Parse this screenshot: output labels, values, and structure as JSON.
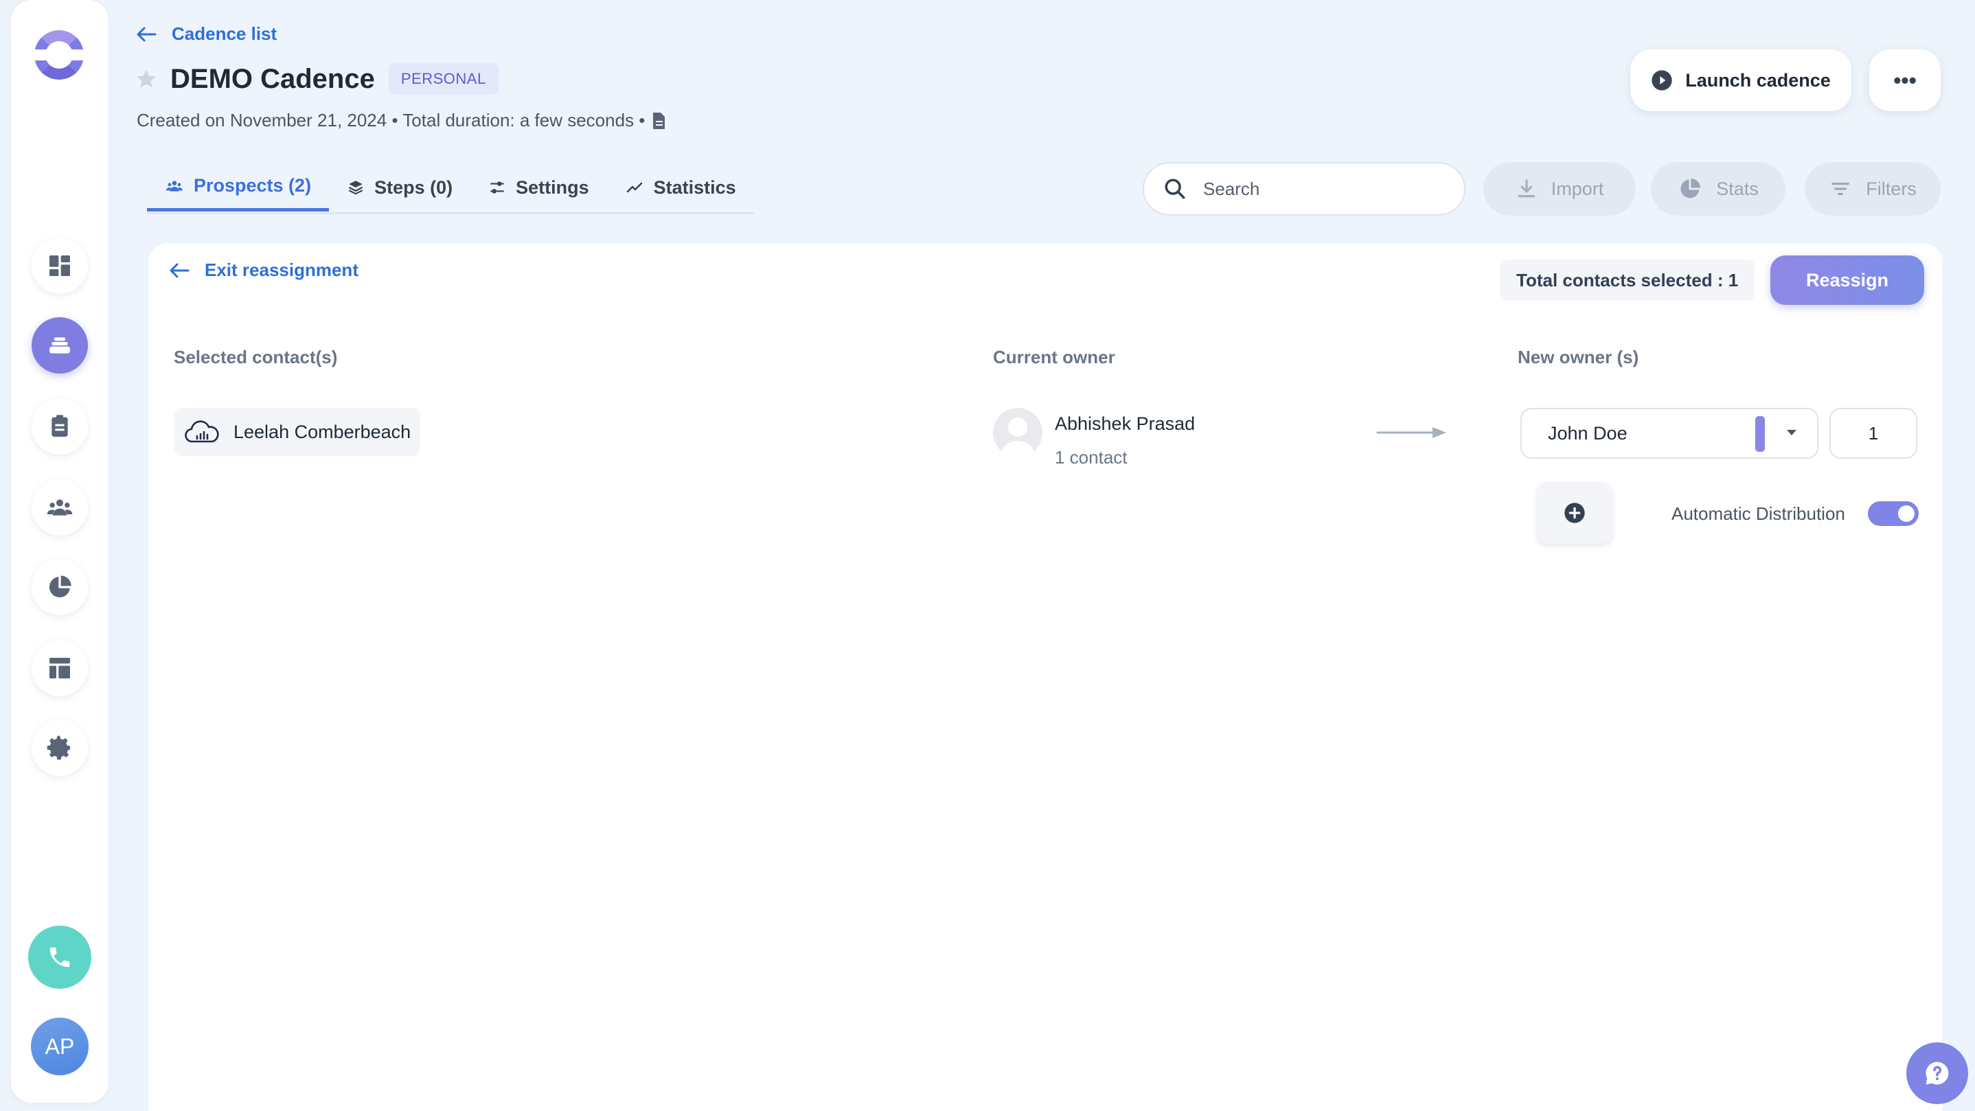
{
  "app": {
    "colors": {
      "accent": "#7f7ce2",
      "link": "#2f6fd6",
      "phone": "#5fd5c8"
    }
  },
  "sidebar": {
    "items": [
      {
        "icon": "dashboard-icon"
      },
      {
        "icon": "cadence-stack-icon",
        "active": true
      },
      {
        "icon": "clipboard-icon"
      },
      {
        "icon": "team-icon"
      },
      {
        "icon": "pie-chart-icon"
      },
      {
        "icon": "layout-icon"
      },
      {
        "icon": "gear-icon"
      }
    ],
    "phone_icon": "phone-icon",
    "avatar_initials": "AP"
  },
  "header": {
    "back_label": "Cadence list",
    "title": "DEMO Cadence",
    "badge": "PERSONAL",
    "meta": "Created on November 21, 2024 • Total duration: a few seconds •",
    "launch_label": "Launch cadence",
    "more_label": "•••"
  },
  "tabs": [
    {
      "label": "Prospects (2)",
      "active": true
    },
    {
      "label": "Steps (0)"
    },
    {
      "label": "Settings"
    },
    {
      "label": "Statistics"
    }
  ],
  "toolbar": {
    "search_placeholder": "Search",
    "import_label": "Import",
    "stats_label": "Stats",
    "filters_label": "Filters"
  },
  "reassignment": {
    "exit_label": "Exit reassignment",
    "total_selected": "Total contacts selected : 1",
    "reassign_label": "Reassign",
    "col_selected": "Selected contact(s)",
    "col_current_owner": "Current owner",
    "col_new_owner": "New owner (s)",
    "contact_name": "Leelah Comberbeach",
    "current_owner_name": "Abhishek Prasad",
    "current_owner_count": "1 contact",
    "new_owner_value": "John Doe",
    "new_owner_qty": "1",
    "auto_distribution_label": "Automatic Distribution",
    "auto_distribution_on": true
  }
}
